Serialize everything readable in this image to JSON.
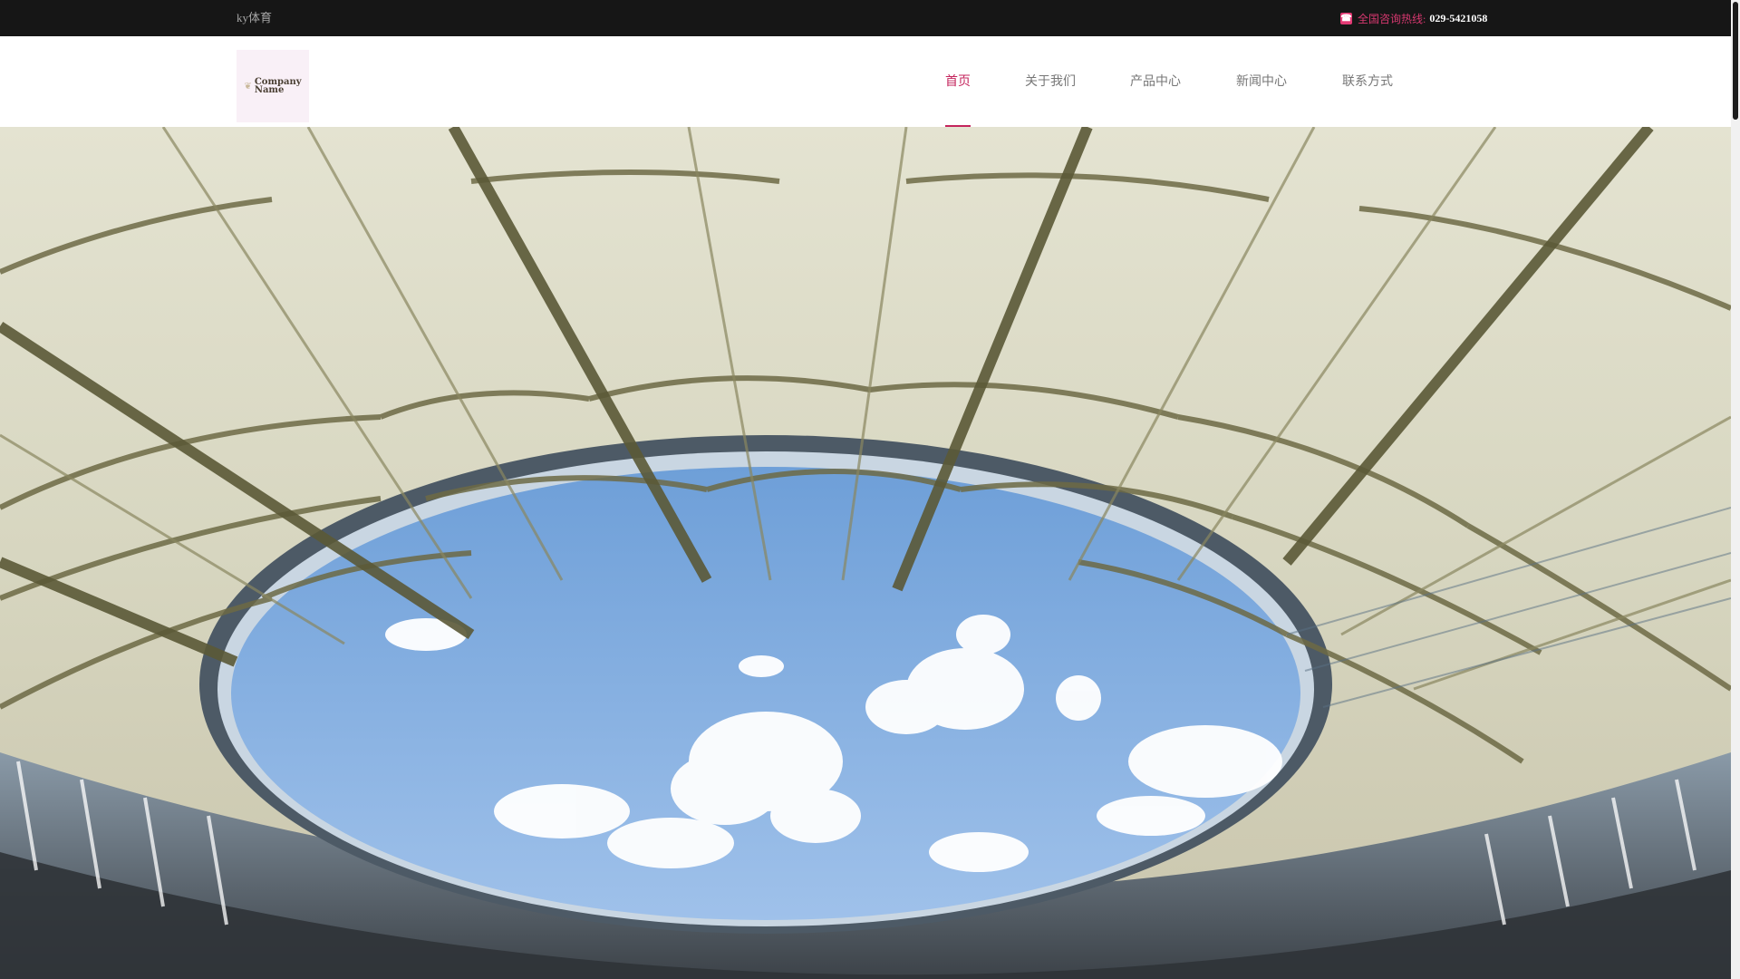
{
  "topbar": {
    "site_name": "ky体育",
    "hotline_label": "全国咨询热线:",
    "hotline_number": "029-5421058",
    "phone_icon": "phone-icon"
  },
  "logo": {
    "text_line1": "Company",
    "text_line2": "Name",
    "icon": "leaf-icon"
  },
  "nav": {
    "items": [
      {
        "label": "首页",
        "active": true
      },
      {
        "label": "关于我们",
        "active": false
      },
      {
        "label": "产品中心",
        "active": false
      },
      {
        "label": "新闻中心",
        "active": false
      },
      {
        "label": "联系方式",
        "active": false
      }
    ]
  },
  "colors": {
    "accent": "#c4245c",
    "hotline_label": "#d6386f",
    "topbar_bg": "#161616",
    "nav_text": "#777777"
  },
  "hero": {
    "description_icon": "stadium-roof-banner-image"
  }
}
